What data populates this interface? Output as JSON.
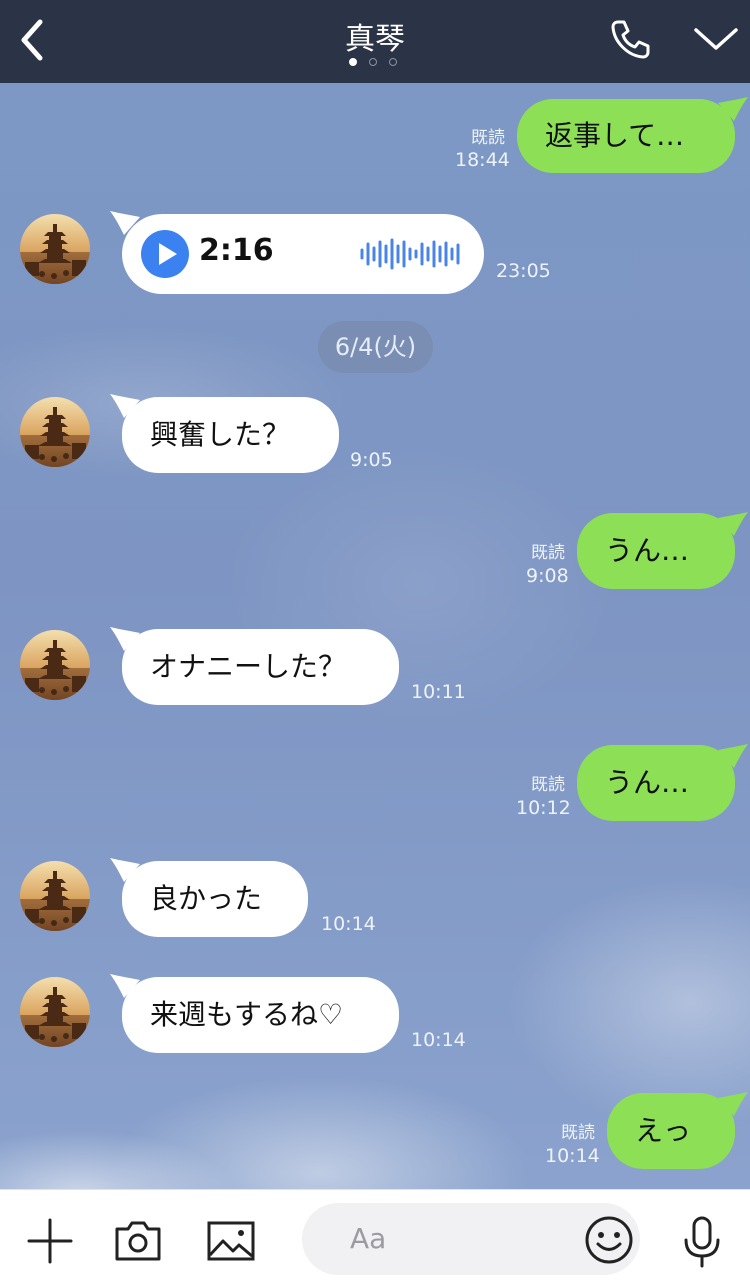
{
  "header": {
    "title": "真琴",
    "page_count": 3,
    "active_page": 1
  },
  "chat": {
    "date_separator": "6/4(火)",
    "messages": [
      {
        "side": "out",
        "text": "返事して…",
        "read": "既読",
        "time": "18:44"
      },
      {
        "side": "in",
        "type": "voice",
        "duration": "2:16",
        "time": "23:05"
      },
      {
        "side": "in",
        "text": "興奮した？",
        "time": "9:05"
      },
      {
        "side": "out",
        "text": "うん…",
        "read": "既読",
        "time": "9:08"
      },
      {
        "side": "in",
        "text": "オナニーした？",
        "time": "10:11"
      },
      {
        "side": "out",
        "text": "うん…",
        "read": "既読",
        "time": "10:12"
      },
      {
        "side": "in",
        "text": "良かった",
        "time": "10:14"
      },
      {
        "side": "in",
        "text": "来週もするね♡",
        "time": "10:14"
      },
      {
        "side": "out",
        "text": "えっ",
        "read": "既読",
        "time": "10:14"
      }
    ]
  },
  "input": {
    "placeholder": "Aa"
  },
  "icons": {
    "back": "chevron-left-icon",
    "call": "phone-icon",
    "menu": "chevron-down-icon",
    "add": "plus-icon",
    "camera": "camera-icon",
    "image": "image-icon",
    "emoji": "smiley-icon",
    "mic": "microphone-icon",
    "play": "play-icon"
  },
  "colors": {
    "header_bg": "#2b3347",
    "chat_bg": "#7e95c3",
    "out_bubble": "#8de055",
    "in_bubble": "#ffffff",
    "play_button": "#3b82f0",
    "waveform": "#4a84e8"
  }
}
